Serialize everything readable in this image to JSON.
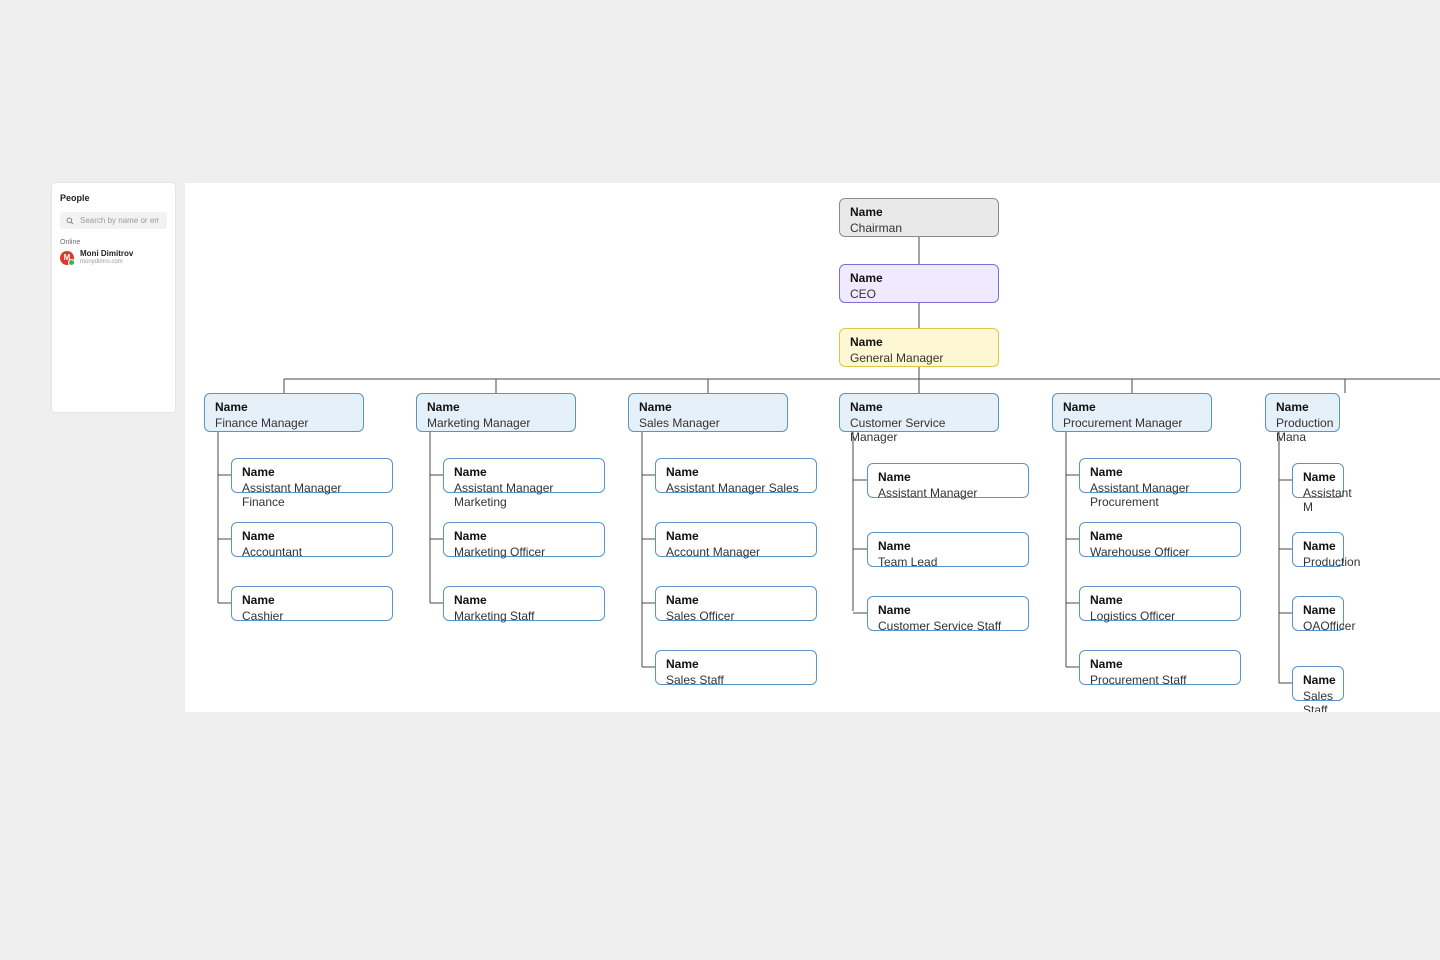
{
  "sidebar": {
    "title": "People",
    "search_placeholder": "Search by name or email",
    "status_label": "Online",
    "user": {
      "initial": "M",
      "name": "Moni Dimitrov",
      "sub": "monydimro.com"
    }
  },
  "org": {
    "name_label": "Name",
    "top": [
      {
        "role": "Chairman"
      },
      {
        "role": "CEO"
      },
      {
        "role": "General Manager"
      }
    ],
    "branches": [
      {
        "role": "Finance Manager",
        "children": [
          "Assistant Manager Finance",
          "Accountant",
          "Cashier"
        ]
      },
      {
        "role": "Marketing Manager",
        "children": [
          "Assistant Manager Marketing",
          "Marketing Officer",
          "Marketing Staff"
        ]
      },
      {
        "role": "Sales Manager",
        "children": [
          "Assistant Manager Sales",
          "Account Manager",
          "Sales Officer",
          "Sales Staff"
        ]
      },
      {
        "role": "Customer Service Manager",
        "children": [
          "Assistant Manager",
          "Team Lead",
          "Customer Service Staff"
        ]
      },
      {
        "role": "Procurement Manager",
        "children": [
          "Assistant Manager Procurement",
          "Warehouse Officer",
          "Logistics Officer",
          "Procurement Staff"
        ]
      },
      {
        "role": "Production Mana",
        "children": [
          "Assistant M",
          "Production",
          "OAOfficer",
          "Sales Staff"
        ]
      }
    ]
  }
}
